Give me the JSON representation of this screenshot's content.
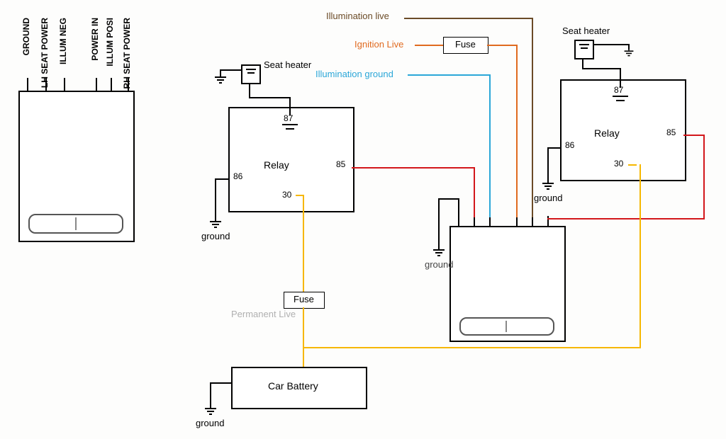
{
  "connector": {
    "pins": [
      "GROUND",
      "LH SEAT POWER",
      "ILLUM NEG",
      "POWER IN",
      "ILLUM POSI",
      "RH SEAT POWER"
    ]
  },
  "seat_heaters": {
    "left": "Seat heater",
    "right": "Seat heater"
  },
  "relays": {
    "left": {
      "label": "Relay",
      "pin87": "87",
      "pin86": "86",
      "pin85": "85",
      "pin30": "30"
    },
    "right": {
      "label": "Relay",
      "pin87": "87",
      "pin86": "86",
      "pin85": "85",
      "pin30": "30"
    }
  },
  "fuses": {
    "ignition": "Fuse",
    "battery": "Fuse"
  },
  "wires": {
    "illum_live": "Illumination live",
    "ignition_live": "Ignition Live",
    "illum_ground": "Illumination ground",
    "perm_live": "Permanent Live"
  },
  "grounds": {
    "lbl": "ground"
  },
  "battery": {
    "label": "Car Battery"
  },
  "colors": {
    "illum_live": "#6b4b27",
    "ignition": "#e06a1f",
    "illum_ground": "#2ba7d8",
    "relay_trigger": "#d3171b",
    "power": "#f6b700"
  }
}
